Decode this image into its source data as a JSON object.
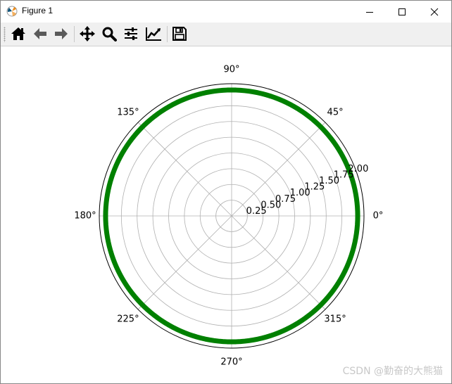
{
  "window": {
    "title": "Figure 1"
  },
  "toolbar": {
    "buttons": [
      {
        "name": "home",
        "icon": "home-icon"
      },
      {
        "name": "back",
        "icon": "arrow-left-icon"
      },
      {
        "name": "forward",
        "icon": "arrow-right-icon"
      },
      {
        "name": "pan",
        "icon": "move-icon"
      },
      {
        "name": "zoom",
        "icon": "magnifier-icon"
      },
      {
        "name": "configure-subplots",
        "icon": "sliders-icon"
      },
      {
        "name": "edit-axis",
        "icon": "line-chart-icon"
      },
      {
        "name": "save",
        "icon": "floppy-disk-icon"
      }
    ]
  },
  "chart_data": {
    "type": "line",
    "projection": "polar",
    "series": [
      {
        "theta_deg": [
          0,
          360
        ],
        "r": [
          2.0,
          2.0
        ],
        "color": "#008000"
      }
    ],
    "angular_ticks": [
      {
        "deg": 0,
        "label": "0°"
      },
      {
        "deg": 45,
        "label": "45°"
      },
      {
        "deg": 90,
        "label": "90°"
      },
      {
        "deg": 135,
        "label": "135°"
      },
      {
        "deg": 180,
        "label": "180°"
      },
      {
        "deg": 225,
        "label": "225°"
      },
      {
        "deg": 270,
        "label": "270°"
      },
      {
        "deg": 315,
        "label": "315°"
      }
    ],
    "radial_ticks": [
      {
        "value": 0.25,
        "label": "0.25"
      },
      {
        "value": 0.5,
        "label": "0.50"
      },
      {
        "value": 0.75,
        "label": "0.75"
      },
      {
        "value": 1.0,
        "label": "1.00"
      },
      {
        "value": 1.25,
        "label": "1.25"
      },
      {
        "value": 1.5,
        "label": "1.50"
      },
      {
        "value": 1.75,
        "label": "1.75"
      },
      {
        "value": 2.0,
        "label": "2.00"
      }
    ],
    "rlim": [
      0,
      2.1
    ],
    "grid": true,
    "grid_color": "#b0b0b0"
  },
  "watermark": {
    "text": "CSDN @勤奋的大熊猫"
  }
}
